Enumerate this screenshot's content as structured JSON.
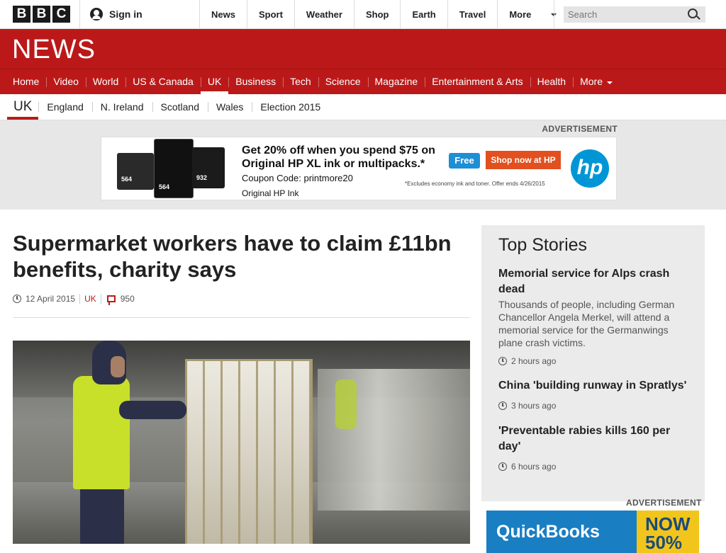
{
  "top_bar": {
    "logo_letters": [
      "B",
      "B",
      "C"
    ],
    "sign_in": "Sign in",
    "nav": [
      "News",
      "Sport",
      "Weather",
      "Shop",
      "Earth",
      "Travel",
      "More"
    ],
    "search_placeholder": "Search"
  },
  "news_band": {
    "title": "NEWS",
    "nav": [
      "Home",
      "Video",
      "World",
      "US & Canada",
      "UK",
      "Business",
      "Tech",
      "Science",
      "Magazine",
      "Entertainment & Arts",
      "Health",
      "More"
    ],
    "active": "UK"
  },
  "sub_nav": {
    "section": "UK",
    "items": [
      "England",
      "N. Ireland",
      "Scotland",
      "Wales",
      "Election 2015"
    ]
  },
  "top_ad": {
    "label": "ADVERTISEMENT",
    "headline_line1": "Get 20% off when you spend $75 on",
    "headline_line2": "Original HP XL ink or multipacks.*",
    "coupon_label": "Coupon Code:",
    "coupon_code": "printmore20",
    "product_line": "Original HP Ink",
    "free_badge": "Free",
    "shop_button": "Shop now at HP",
    "fine_print": "*Excludes economy ink and toner.  Offer ends 4/26/2015",
    "brand": "hp",
    "cartridge_labels": [
      "564",
      "564",
      "932"
    ]
  },
  "article": {
    "headline": "Supermarket workers have to claim £11bn benefits, charity says",
    "date": "12 April 2015",
    "topic": "UK",
    "comments": "950"
  },
  "sidebar": {
    "title": "Top Stories",
    "stories": [
      {
        "headline": "Memorial service for Alps crash dead",
        "summary": "Thousands of people, including German Chancellor Angela Merkel, will attend a memorial service for the Germanwings plane crash victims.",
        "time": "2 hours ago"
      },
      {
        "headline": "China 'building runway in Spratlys'",
        "time": "3 hours ago"
      },
      {
        "headline": "'Preventable rabies kills 160 per day'",
        "time": "6 hours ago"
      }
    ]
  },
  "side_ad": {
    "label": "ADVERTISEMENT",
    "brand": "QuickBooks",
    "promo": "NOW 50%"
  },
  "colors": {
    "bbc_red": "#bb1919",
    "hp_blue": "#0096d6",
    "shop_orange": "#e2501f"
  }
}
